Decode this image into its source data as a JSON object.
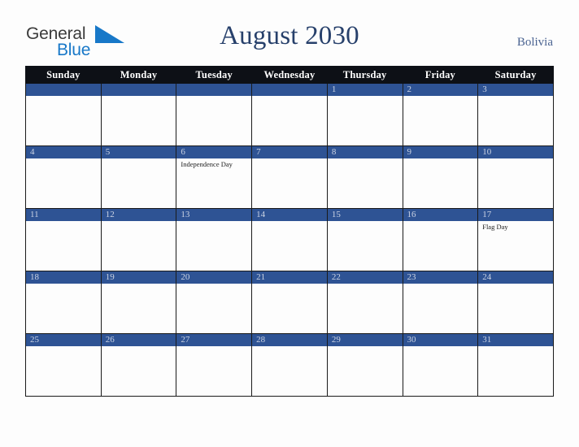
{
  "brand": {
    "name_part1": "General",
    "name_part2": "Blue",
    "triangle_color": "#1878c8",
    "text_color": "#3b3b3b"
  },
  "header": {
    "title": "August 2030",
    "country": "Bolivia",
    "title_color": "#27406b",
    "country_color": "#4a6391"
  },
  "calendar": {
    "weekday_headers": [
      "Sunday",
      "Monday",
      "Tuesday",
      "Wednesday",
      "Thursday",
      "Friday",
      "Saturday"
    ],
    "header_bg": "#0d1016",
    "header_text_color": "#ffffff",
    "daybar_bg": "#2e5394",
    "daybar_text_color": "#ccd4e4",
    "cell_bg": "#fdfdfd",
    "weeks": [
      [
        {
          "date": "",
          "events": []
        },
        {
          "date": "",
          "events": []
        },
        {
          "date": "",
          "events": []
        },
        {
          "date": "",
          "events": []
        },
        {
          "date": "1",
          "events": []
        },
        {
          "date": "2",
          "events": []
        },
        {
          "date": "3",
          "events": []
        }
      ],
      [
        {
          "date": "4",
          "events": []
        },
        {
          "date": "5",
          "events": []
        },
        {
          "date": "6",
          "events": [
            "Independence Day"
          ]
        },
        {
          "date": "7",
          "events": []
        },
        {
          "date": "8",
          "events": []
        },
        {
          "date": "9",
          "events": []
        },
        {
          "date": "10",
          "events": []
        }
      ],
      [
        {
          "date": "11",
          "events": []
        },
        {
          "date": "12",
          "events": []
        },
        {
          "date": "13",
          "events": []
        },
        {
          "date": "14",
          "events": []
        },
        {
          "date": "15",
          "events": []
        },
        {
          "date": "16",
          "events": []
        },
        {
          "date": "17",
          "events": [
            "Flag Day"
          ]
        }
      ],
      [
        {
          "date": "18",
          "events": []
        },
        {
          "date": "19",
          "events": []
        },
        {
          "date": "20",
          "events": []
        },
        {
          "date": "21",
          "events": []
        },
        {
          "date": "22",
          "events": []
        },
        {
          "date": "23",
          "events": []
        },
        {
          "date": "24",
          "events": []
        }
      ],
      [
        {
          "date": "25",
          "events": []
        },
        {
          "date": "26",
          "events": []
        },
        {
          "date": "27",
          "events": []
        },
        {
          "date": "28",
          "events": []
        },
        {
          "date": "29",
          "events": []
        },
        {
          "date": "30",
          "events": []
        },
        {
          "date": "31",
          "events": []
        }
      ]
    ]
  }
}
